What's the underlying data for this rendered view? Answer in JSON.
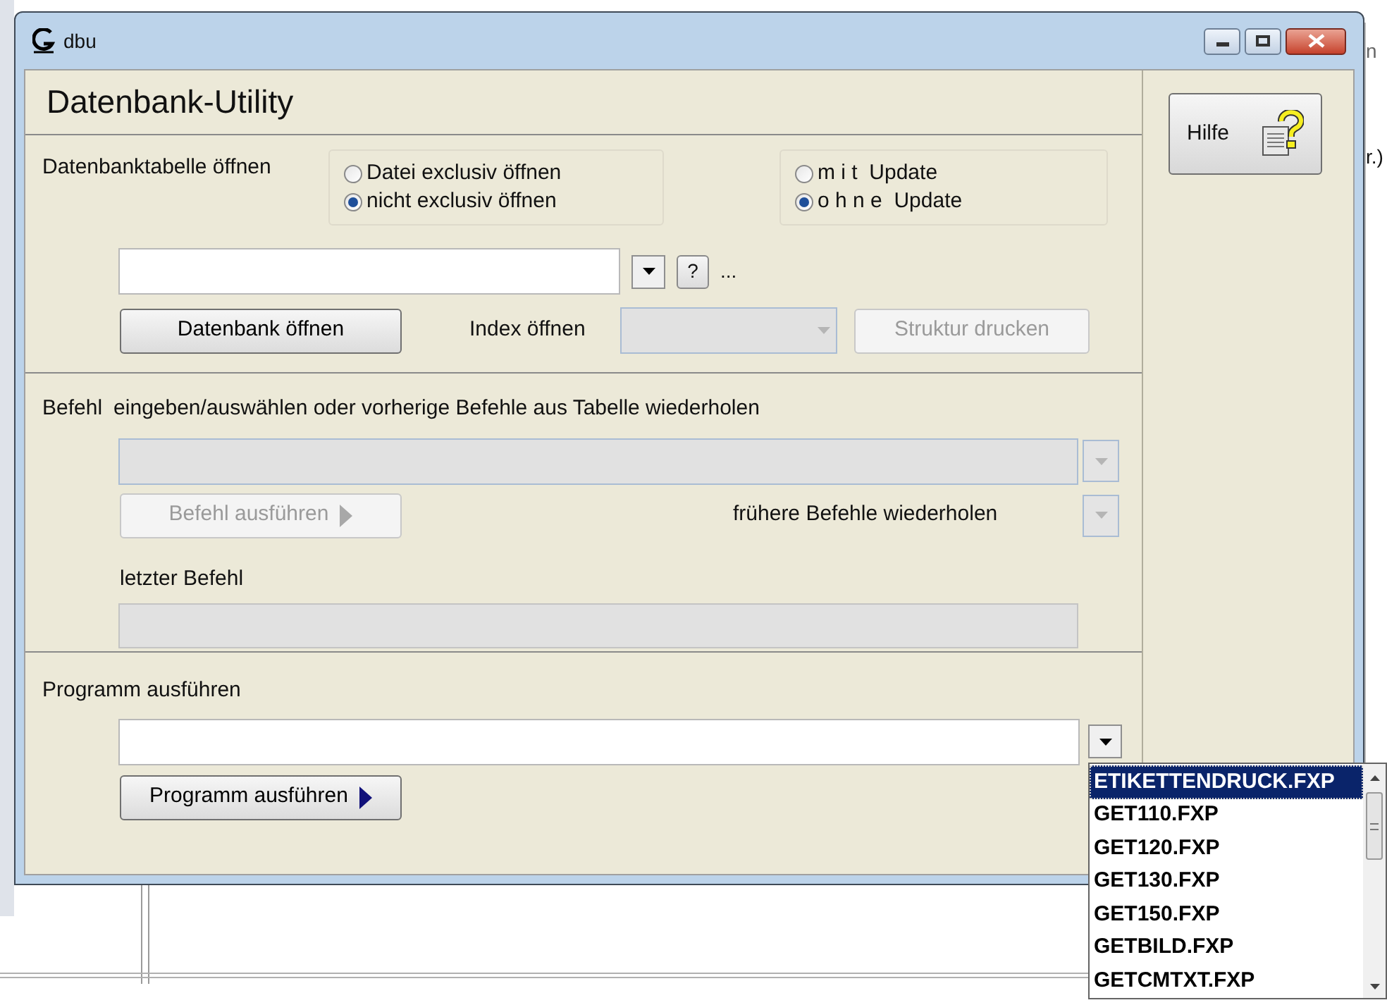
{
  "background": {
    "texts": [
      "n",
      "r.)"
    ]
  },
  "window": {
    "title": "dbu"
  },
  "heading": "Datenbank-Utility",
  "open_section": {
    "label": "Datenbanktabelle öffnen",
    "radio_groups": [
      [
        {
          "label": "Datei exclusiv öffnen",
          "selected": false
        },
        {
          "label": "nicht exclusiv öffnen",
          "selected": true
        }
      ],
      [
        {
          "label": "m i t  Update",
          "selected": false
        },
        {
          "label": "o h n e  Update",
          "selected": true
        }
      ]
    ],
    "help_button": "?",
    "ellipsis": "...",
    "open_button": {
      "label": "Datenbank öffnen",
      "disabled": false
    },
    "index_label": "Index öffnen",
    "index_combo": {
      "disabled": true
    },
    "structure_button": {
      "label": "Struktur drucken",
      "disabled": true
    }
  },
  "command_section": {
    "label": "Befehl",
    "hint": "eingeben/auswählen oder vorherige Befehle aus Tabelle wiederholen",
    "command_combo": {
      "disabled": true
    },
    "run_button": {
      "label": "Befehl ausführen",
      "disabled": true
    },
    "history_label": "frühere Befehle wiederholen",
    "history_combo": {
      "disabled": true
    },
    "last_label": "letzter Befehl",
    "last_field": {
      "disabled": true
    }
  },
  "program_section": {
    "label": "Programm ausführen",
    "program_combo": {
      "disabled": false
    },
    "run_button": {
      "label": "Programm ausführen",
      "disabled": false
    }
  },
  "side": {
    "help_button": {
      "label": "Hilfe"
    }
  },
  "dropdown_list": [
    {
      "label": "ETIKETTENDRUCK.FXP",
      "selected": true
    },
    {
      "label": "GET110.FXP",
      "selected": false
    },
    {
      "label": "GET120.FXP",
      "selected": false
    },
    {
      "label": "GET130.FXP",
      "selected": false
    },
    {
      "label": "GET150.FXP",
      "selected": false
    },
    {
      "label": "GETBILD.FXP",
      "selected": false
    },
    {
      "label": "GETCMTXT.FXP",
      "selected": false
    }
  ]
}
